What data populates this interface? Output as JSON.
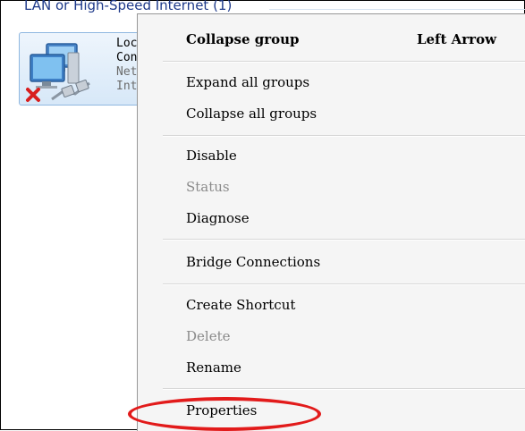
{
  "group": {
    "header": "LAN or High-Speed Internet (1)"
  },
  "connection": {
    "line1": "Local",
    "line2": "Conne",
    "line3": "Netwo",
    "line4": "Intel"
  },
  "icons": {
    "network": "network-computers-icon",
    "disconnected": "red-x-icon",
    "cable": "network-cable-icon"
  },
  "context_menu": {
    "collapse_group": "Collapse group",
    "collapse_group_shortcut": "Left Arrow",
    "expand_all_groups": "Expand all groups",
    "collapse_all_groups": "Collapse all groups",
    "disable": "Disable",
    "status": "Status",
    "diagnose": "Diagnose",
    "bridge_connections": "Bridge Connections",
    "create_shortcut": "Create Shortcut",
    "delete": "Delete",
    "rename": "Rename",
    "properties": "Properties"
  },
  "colors": {
    "highlight_oval": "#e21b1b",
    "group_header": "#1e3a8a"
  }
}
